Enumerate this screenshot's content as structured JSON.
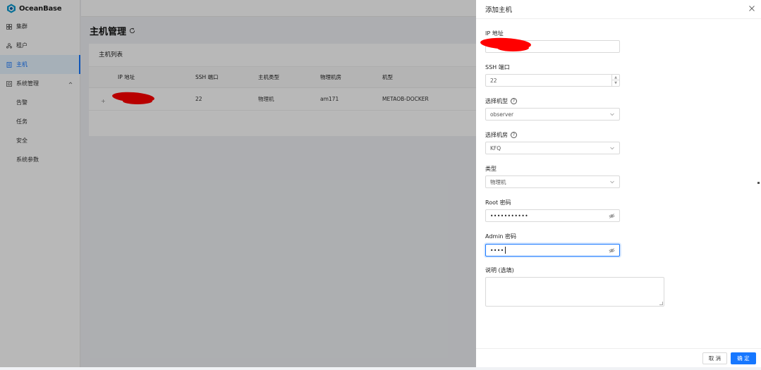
{
  "app": {
    "logo_text": "OceanBase",
    "brand_color": "#1677ff"
  },
  "sidebar": {
    "items": [
      {
        "label": "集群",
        "icon": "grid-icon"
      },
      {
        "label": "租户",
        "icon": "users-icon"
      },
      {
        "label": "主机",
        "icon": "server-icon",
        "active": true
      },
      {
        "label": "系统管理",
        "icon": "settings-icon",
        "expanded": true
      }
    ],
    "sub_items": [
      "告警",
      "任务",
      "安全",
      "系统参数"
    ]
  },
  "page": {
    "title": "主机管理"
  },
  "host_list": {
    "title": "主机列表",
    "columns": [
      "IP 地址",
      "SSH 端口",
      "主机类型",
      "物理机房",
      "机型"
    ],
    "rows": [
      {
        "ip": "",
        "ssh_port": "22",
        "host_type": "物理机",
        "idc": "am171",
        "model": "METAOB-DOCKER"
      }
    ]
  },
  "drawer": {
    "title": "添加主机",
    "fields": {
      "ip": {
        "label": "IP 地址",
        "value": ""
      },
      "ssh_port": {
        "label": "SSH 端口",
        "value": "22"
      },
      "model": {
        "label": "选择机型",
        "value": "observer"
      },
      "idc": {
        "label": "选择机房",
        "value": "KFQ"
      },
      "type": {
        "label": "类型",
        "value": "物理机"
      },
      "root_password": {
        "label": "Root 密码",
        "value": "•••••••••••"
      },
      "admin_password": {
        "label": "Admin 密码",
        "value": "••••"
      },
      "description": {
        "label": "说明 (选填)",
        "value": ""
      }
    },
    "cancel_label": "取 消",
    "ok_label": "确 定"
  }
}
